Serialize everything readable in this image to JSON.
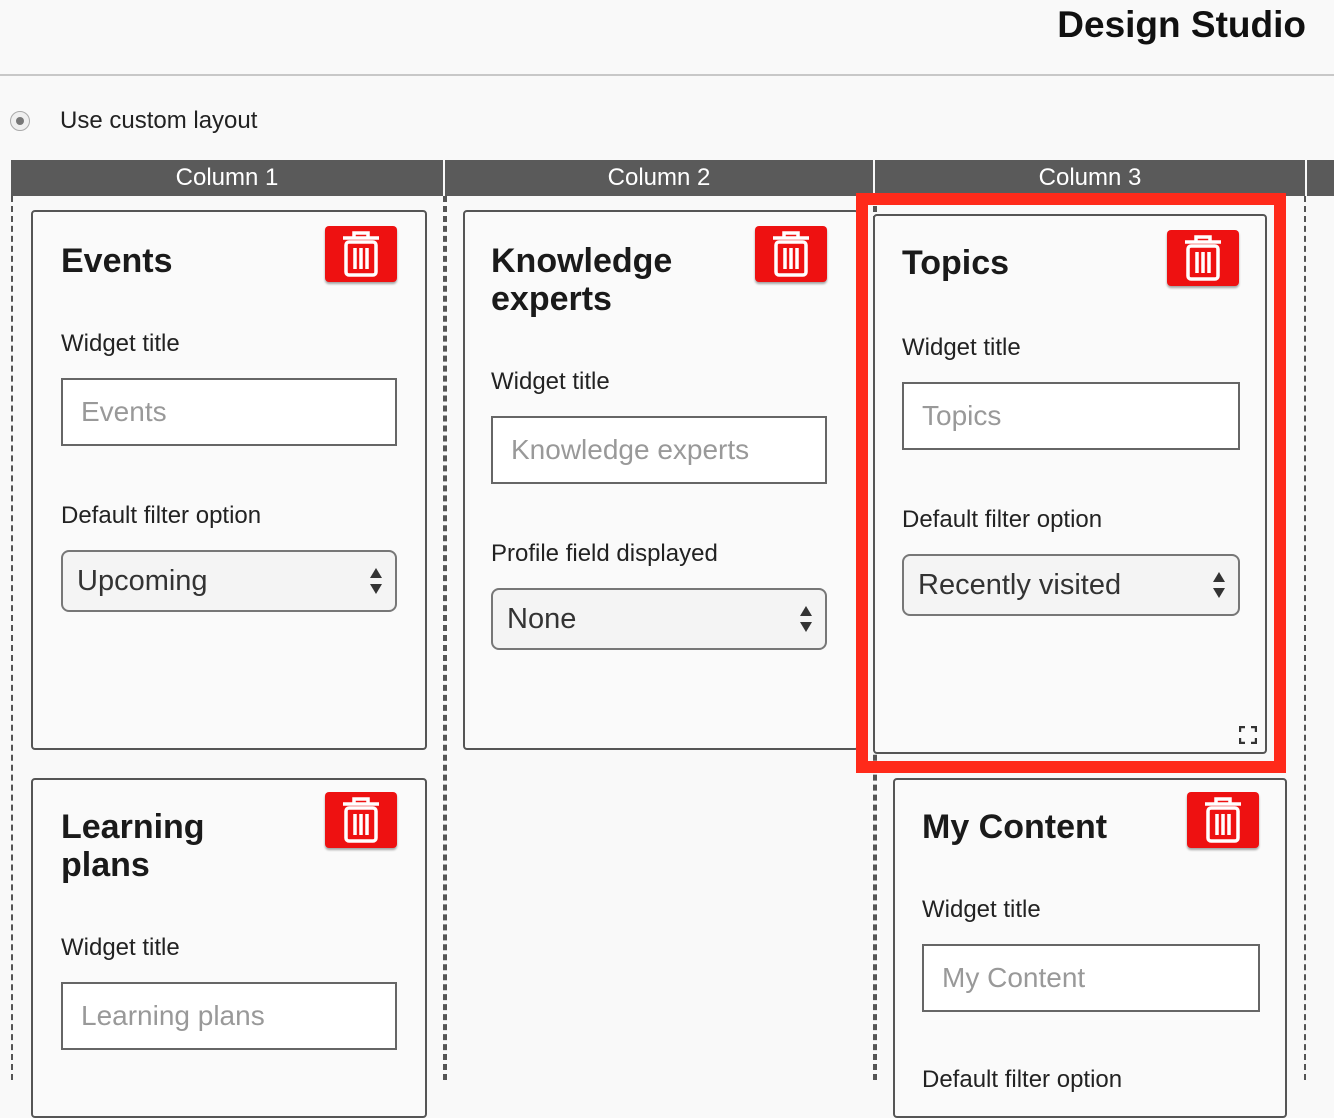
{
  "header": {
    "title": "Design Studio"
  },
  "layout": {
    "option_label": "Use custom layout",
    "selected": true
  },
  "columns": [
    {
      "label": "Column 1"
    },
    {
      "label": "Column 2"
    },
    {
      "label": "Column 3"
    }
  ],
  "widgets": {
    "events": {
      "title": "Events",
      "widget_title_label": "Widget title",
      "widget_title_placeholder": "Events",
      "filter_label": "Default filter option",
      "filter_value": "Upcoming"
    },
    "knowledge_experts": {
      "title_line1": "Knowledge",
      "title_line2": "experts",
      "widget_title_label": "Widget title",
      "widget_title_placeholder": "Knowledge experts",
      "profile_label": "Profile field displayed",
      "profile_value": "None"
    },
    "topics": {
      "title": "Topics",
      "widget_title_label": "Widget title",
      "widget_title_placeholder": "Topics",
      "filter_label": "Default filter option",
      "filter_value": "Recently visited"
    },
    "learning_plans": {
      "title_line1": "Learning",
      "title_line2": "plans",
      "widget_title_label": "Widget title",
      "widget_title_placeholder": "Learning plans"
    },
    "my_content": {
      "title": "My Content",
      "widget_title_label": "Widget title",
      "widget_title_placeholder": "My Content",
      "filter_label": "Default filter option"
    }
  },
  "colors": {
    "delete": "#ee1111",
    "highlight": "#ff2a1a",
    "column_header": "#5a5a5a"
  },
  "icons": {
    "delete": "trash-icon",
    "select": "updown-arrows-icon",
    "resize": "resize-handle-icon"
  }
}
